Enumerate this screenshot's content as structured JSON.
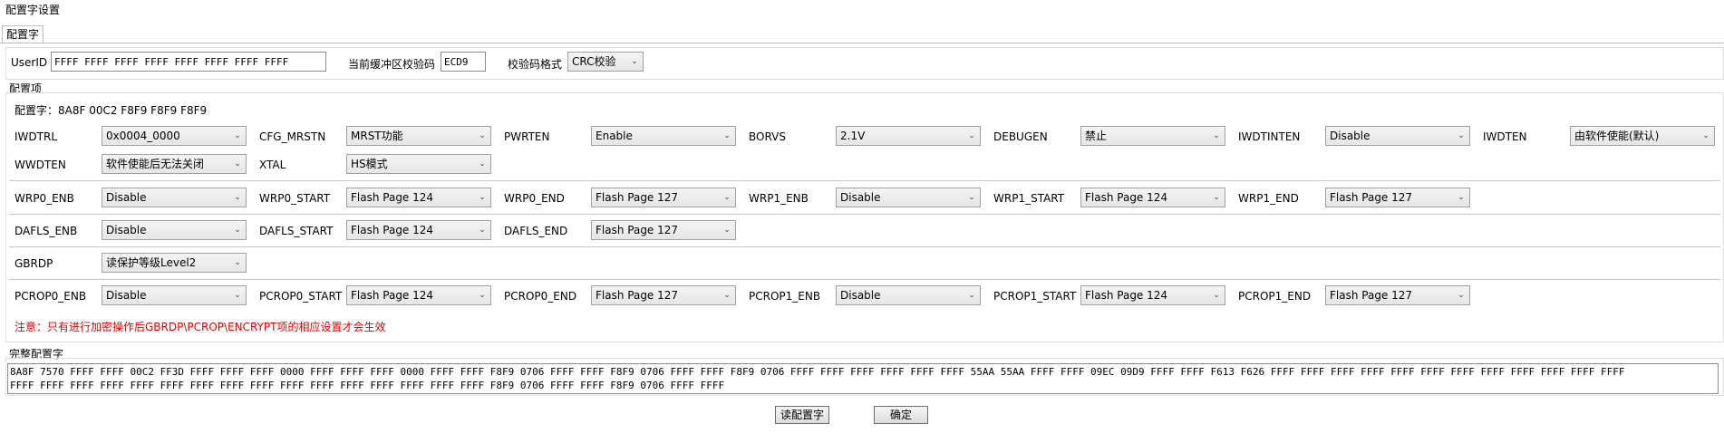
{
  "window": {
    "title": "配置字设置"
  },
  "tab": {
    "label": "配置字"
  },
  "top": {
    "userid_label": "UserID",
    "userid_value": "FFFF FFFF FFFF FFFF FFFF FFFF FFFF FFFF",
    "crc_label": "当前缓冲区校验码",
    "crc_value": "ECD9",
    "format_label": "校验码格式",
    "format_value": "CRC校验"
  },
  "group": {
    "title": "配置项",
    "config_word": "配置字：8A8F 00C2 F8F9 F8F9 F8F9",
    "fields": [
      {
        "label": "IWDTRL",
        "value": "0x0004_0000"
      },
      {
        "label": "CFG_MRSTN",
        "value": "MRST功能"
      },
      {
        "label": "PWRTEN",
        "value": "Enable"
      },
      {
        "label": "BORVS",
        "value": "2.1V"
      },
      {
        "label": "DEBUGEN",
        "value": "禁止"
      },
      {
        "label": "IWDTINTEN",
        "value": "Disable"
      },
      {
        "label": "IWDTEN",
        "value": "由软件使能(默认)"
      },
      {
        "label": "WWDTEN",
        "value": "软件使能后无法关闭"
      },
      {
        "label": "XTAL",
        "value": "HS模式"
      },
      {
        "label": "WRP0_ENB",
        "value": "Disable"
      },
      {
        "label": "WRP0_START",
        "value": "Flash Page 124"
      },
      {
        "label": "WRP0_END",
        "value": "Flash Page 127"
      },
      {
        "label": "WRP1_ENB",
        "value": "Disable"
      },
      {
        "label": "WRP1_START",
        "value": "Flash Page 124"
      },
      {
        "label": "WRP1_END",
        "value": "Flash Page 127"
      },
      {
        "label": "DAFLS_ENB",
        "value": "Disable"
      },
      {
        "label": "DAFLS_START",
        "value": "Flash Page 124"
      },
      {
        "label": "DAFLS_END",
        "value": "Flash Page 127"
      },
      {
        "label": "GBRDP",
        "value": "读保护等级Level2"
      },
      {
        "label": "PCROP0_ENB",
        "value": "Disable"
      },
      {
        "label": "PCROP0_START",
        "value": "Flash Page 124"
      },
      {
        "label": "PCROP0_END",
        "value": "Flash Page 127"
      },
      {
        "label": "PCROP1_ENB",
        "value": "Disable"
      },
      {
        "label": "PCROP1_START",
        "value": "Flash Page 124"
      },
      {
        "label": "PCROP1_END",
        "value": "Flash Page 127"
      }
    ],
    "warning": "注意：只有进行加密操作后GBRDP\\PCROP\\ENCRYPT项的相应设置才会生效"
  },
  "full": {
    "title": "完整配置字",
    "line1": "8A8F 7570 FFFF FFFF 00C2 FF3D FFFF FFFF FFFF 0000 FFFF FFFF FFFF 0000 FFFF FFFF F8F9 0706 FFFF FFFF F8F9 0706 FFFF FFFF F8F9 0706 FFFF FFFF FFFF FFFF FFFF FFFF 55AA 55AA FFFF FFFF 09EC 09D9 FFFF FFFF F613 F626 FFFF FFFF FFFF FFFF FFFF FFFF FFFF FFFF FFFF FFFF FFFF FFFF",
    "line2": "FFFF FFFF FFFF FFFF FFFF FFFF FFFF FFFF FFFF FFFF FFFF FFFF FFFF FFFF FFFF FFFF F8F9 0706 FFFF FFFF F8F9 0706 FFFF FFFF"
  },
  "buttons": {
    "read": "读配置字",
    "ok": "确定"
  }
}
